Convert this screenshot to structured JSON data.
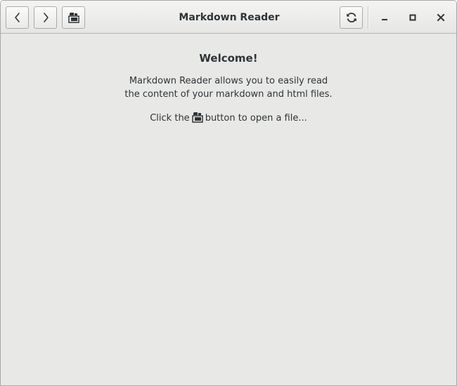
{
  "window": {
    "title": "Markdown Reader"
  },
  "headerbar": {
    "back_icon": "go-back-icon",
    "forward_icon": "go-forward-icon",
    "open_icon": "document-open-icon",
    "refresh_icon": "refresh-icon",
    "minimize_icon": "minimize-icon",
    "maximize_icon": "maximize-icon",
    "close_icon": "close-icon"
  },
  "main": {
    "welcome_title": "Welcome!",
    "description_line1": "Markdown Reader allows you to easily read",
    "description_line2": "the content of your markdown and html files.",
    "hint_before": "Click the",
    "hint_after": "button to open a file..."
  },
  "colors": {
    "background": "#e8e8e7",
    "text": "#2e3436",
    "headerbar": "#ececeb"
  }
}
